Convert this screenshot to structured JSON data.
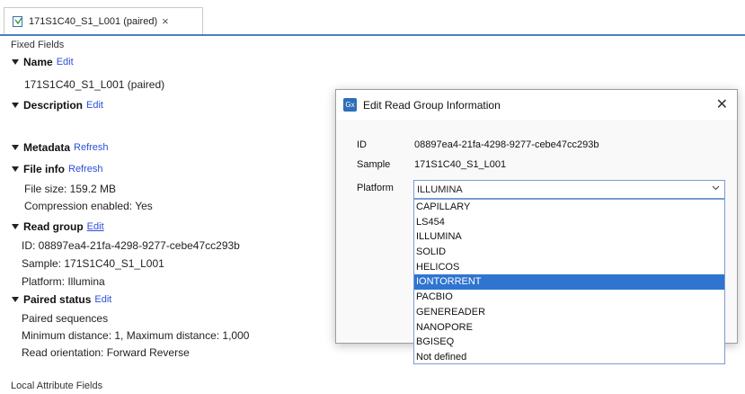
{
  "tab": {
    "title": "171S1C40_S1_L001 (paired)",
    "close": "×"
  },
  "editor": {
    "fixed_fields": "Fixed Fields",
    "name": {
      "label": "Name",
      "action": "Edit",
      "value": "171S1C40_S1_L001 (paired)"
    },
    "description": {
      "label": "Description",
      "action": "Edit"
    },
    "metadata": {
      "label": "Metadata",
      "action": "Refresh"
    },
    "file_info": {
      "label": "File info",
      "action": "Refresh",
      "size": "File size: 159.2 MB",
      "compression": "Compression enabled: Yes"
    },
    "read_group": {
      "label": "Read group",
      "action": "Edit",
      "id": "ID: 08897ea4-21fa-4298-9277-cebe47cc293b",
      "sample": "Sample: 171S1C40_S1_L001",
      "platform": "Platform: Illumina"
    },
    "paired_status": {
      "label": "Paired status",
      "action": "Edit",
      "seq": "Paired sequences",
      "distance": "Minimum distance: 1, Maximum distance: 1,000",
      "orientation": "Read orientation: Forward Reverse"
    },
    "local_fields": "Local Attribute Fields"
  },
  "dialog": {
    "icon": "Gx",
    "title": "Edit Read Group Information",
    "close": "✕",
    "id_label": "ID",
    "id_value": "08897ea4-21fa-4298-9277-cebe47cc293b",
    "sample_label": "Sample",
    "sample_value": "171S1C40_S1_L001",
    "platform_label": "Platform",
    "platform_value": "ILLUMINA",
    "options": [
      "CAPILLARY",
      "LS454",
      "ILLUMINA",
      "SOLID",
      "HELICOS",
      "IONTORRENT",
      "PACBIO",
      "GENEREADER",
      "NANOPORE",
      "BGISEQ",
      "Not defined"
    ],
    "highlighted": "IONTORRENT"
  },
  "colors": {
    "accent": "#2f75d0",
    "link": "#2b4fd8",
    "tab_line": "#4a7fc1"
  }
}
